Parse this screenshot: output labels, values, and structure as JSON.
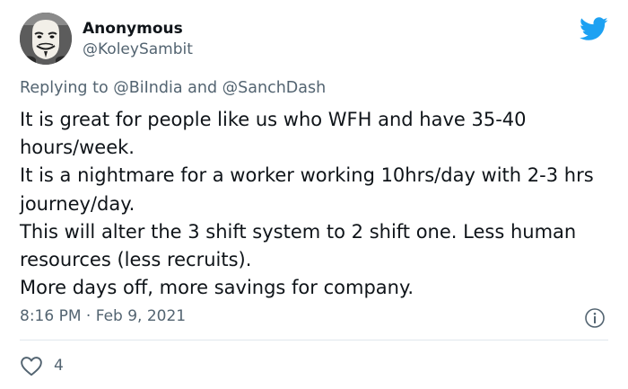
{
  "author": {
    "name": "Anonymous",
    "handle": "@KoleySambit"
  },
  "reply": {
    "prefix": "Replying to",
    "mention_1": "@BiIndia",
    "conjunction": "and",
    "mention_2": "@SanchDash"
  },
  "tweet": {
    "paragraphs": [
      "It is great for people like us who WFH and have 35-40 hours/week.",
      "It is a nightmare for a worker working 10hrs/day with 2-3 hrs journey/day.",
      "This will alter the 3 shift system to 2 shift one. Less human resources (less recruits).",
      "More days off, more savings for company."
    ]
  },
  "meta": {
    "time": "8:16 PM",
    "separator": "·",
    "date": "Feb 9, 2021"
  },
  "engagement": {
    "likes": "4"
  },
  "icons": {
    "logo": "twitter-bird-icon",
    "info": "info-icon",
    "like": "heart-icon"
  },
  "colors": {
    "brand": "#1da1f2",
    "text_primary": "#0f1419",
    "text_secondary": "#536471",
    "divider": "#e1e8ed"
  }
}
